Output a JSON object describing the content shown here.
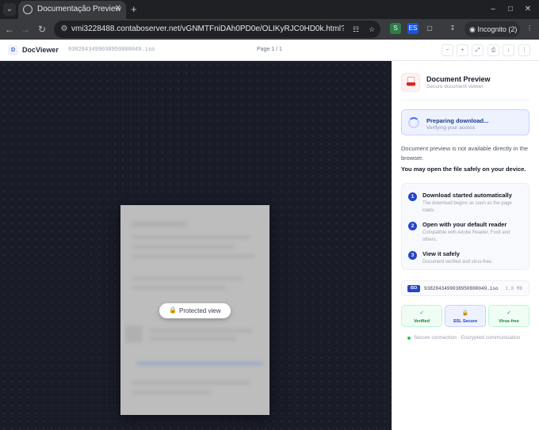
{
  "browser": {
    "tab_title": "Documentação Preview",
    "url": "vmi3228488.contaboserver.net/vGNMTFniDAh0PD0e/OLIKyRJC0HD0k.html?TGoTJxyG0CD...",
    "incognito_label": "Incognito (2)",
    "extension_badge": "ES"
  },
  "viewer": {
    "logo_letter": "D",
    "app_name": "DocViewer",
    "file_name": "9382843499038950800049.iso",
    "page_indicator": "Page 1 / 1",
    "protected_label": "Protected view",
    "toolbar_buttons": [
      "−",
      "+",
      "⤢",
      "⎙",
      "↓",
      "⋮"
    ]
  },
  "sidebar": {
    "title": "Document Preview",
    "subtitle": "Secure document viewer",
    "preparing_title": "Preparing download...",
    "preparing_sub": "Verifying your access",
    "message": "Document preview is not available directly in the browser.",
    "message_bold": "You may open the file safely on your device.",
    "steps": [
      {
        "num": "1",
        "title": "Download started automatically",
        "desc": "The download begins as soon as the page loads."
      },
      {
        "num": "2",
        "title": "Open with your default reader",
        "desc": "Compatible with Adobe Reader, Foxit and others."
      },
      {
        "num": "3",
        "title": "View it safely",
        "desc": "Document verified and virus-free."
      }
    ],
    "file": {
      "badge": "ISO",
      "name": "9382843499038950800049.iso",
      "size": "1.8 MB"
    },
    "badges": [
      {
        "icon": "✓",
        "label": "Verified"
      },
      {
        "icon": "🔒",
        "label": "SSL Secure"
      },
      {
        "icon": "✓",
        "label": "Virus-free"
      }
    ],
    "secure_text": "Secure connection · Encrypted communication"
  }
}
